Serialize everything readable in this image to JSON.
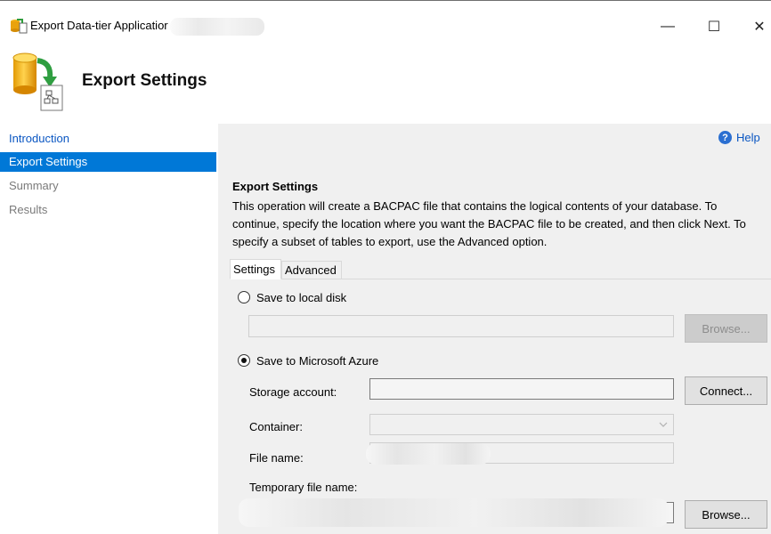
{
  "window": {
    "title": "Export Data-tier Applicatior",
    "minimize": "—",
    "maximize": "☐",
    "close": "✕"
  },
  "header": {
    "title": "Export Settings",
    "icon": "database-export-icon"
  },
  "nav": {
    "items": [
      {
        "label": "Introduction",
        "state": "link"
      },
      {
        "label": "Export Settings",
        "state": "selected"
      },
      {
        "label": "Summary",
        "state": "disabled"
      },
      {
        "label": "Results",
        "state": "disabled"
      }
    ]
  },
  "help": {
    "label": "Help",
    "icon": "help-icon",
    "glyph": "?"
  },
  "section": {
    "title": "Export Settings",
    "description": "This operation will create a BACPAC file that contains the logical contents of your database. To continue, specify the location where you want the BACPAC file to be created, and then click Next. To specify a subset of tables to export, use the Advanced option."
  },
  "tabs": [
    {
      "label": "Settings",
      "selected": true
    },
    {
      "label": "Advanced",
      "selected": false
    }
  ],
  "local": {
    "option_label": "Save to local disk",
    "selected": false,
    "path_value": "",
    "browse_label": "Browse..."
  },
  "azure": {
    "option_label": "Save to Microsoft Azure",
    "selected": true,
    "storage_label": "Storage account:",
    "storage_value": "",
    "connect_label": "Connect...",
    "container_label": "Container:",
    "container_value": "",
    "filename_label": "File name:",
    "temp_label": "Temporary file name:",
    "browse_label": "Browse..."
  },
  "colors": {
    "selected_bg": "#0078d7",
    "link": "#0a56c2",
    "panel_bg": "#f0f0f0"
  }
}
